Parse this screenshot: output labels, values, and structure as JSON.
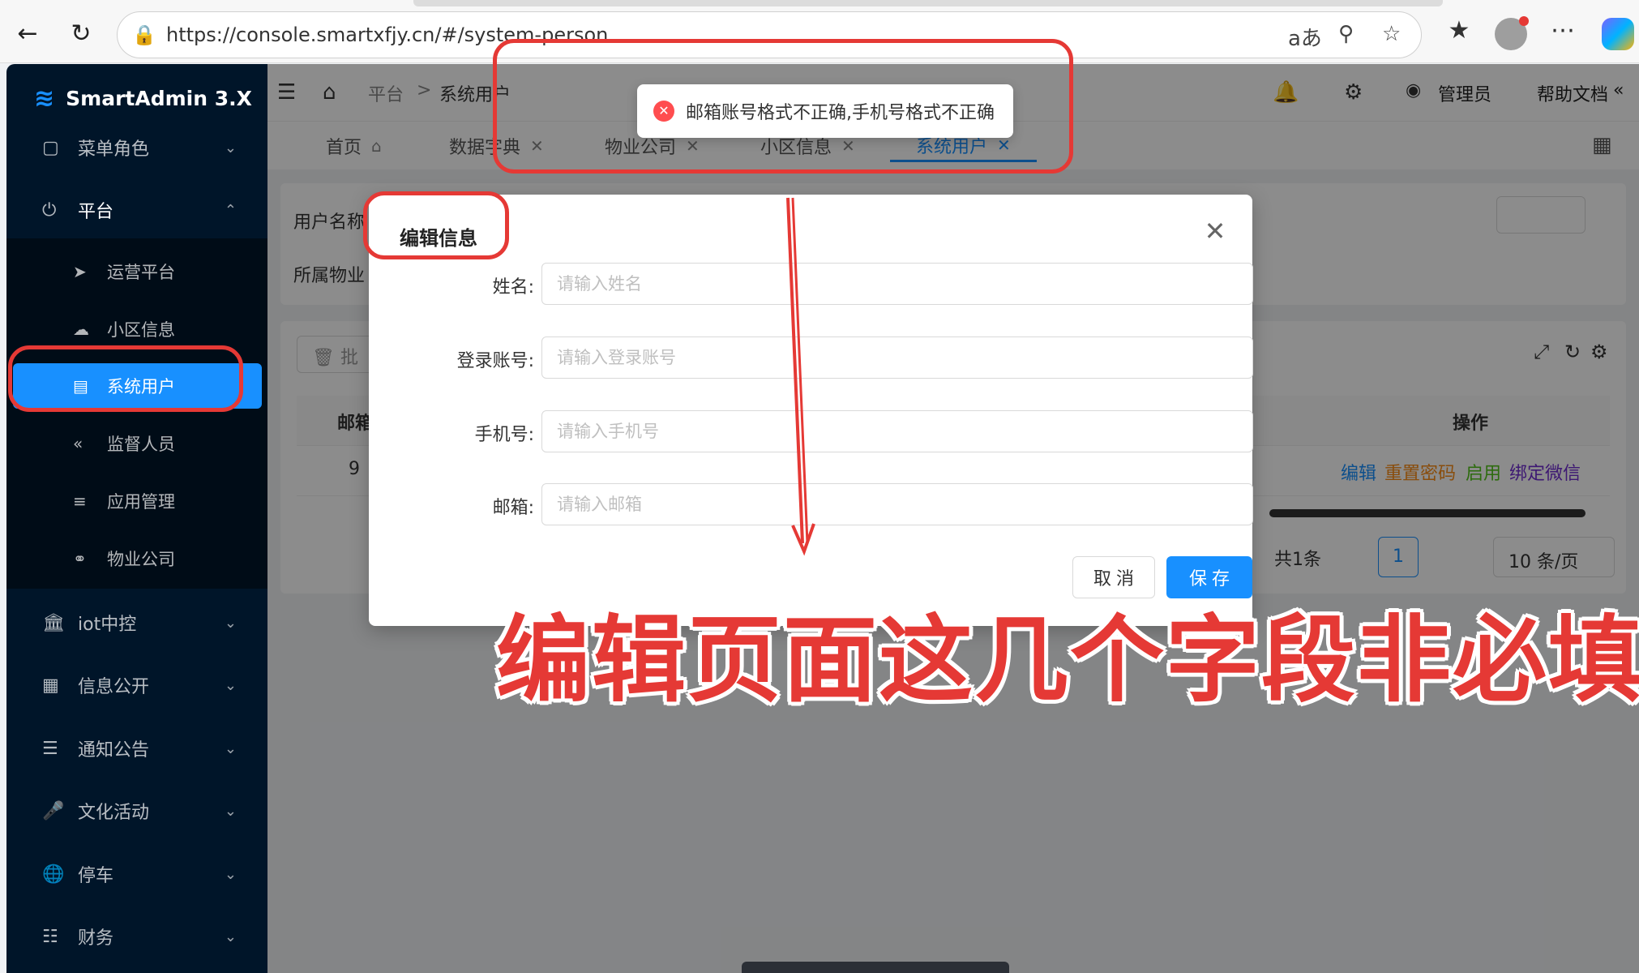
{
  "browser": {
    "url": "https://console.smartxfjy.cn/#/system-person"
  },
  "sidebar": {
    "brand": "SmartAdmin 3.X",
    "items": [
      {
        "label": "菜单角色",
        "icon": "file-icon"
      },
      {
        "label": "平台",
        "icon": "power-icon"
      },
      {
        "label": "iot中控",
        "icon": "bank-icon"
      },
      {
        "label": "信息公开",
        "icon": "grid-icon"
      },
      {
        "label": "通知公告",
        "icon": "list-icon"
      },
      {
        "label": "文化活动",
        "icon": "mic-icon"
      },
      {
        "label": "停车",
        "icon": "globe-icon"
      },
      {
        "label": "财务",
        "icon": "calendar-icon"
      }
    ],
    "sub_items": [
      {
        "label": "运营平台",
        "icon": "rocket-icon"
      },
      {
        "label": "小区信息",
        "icon": "cloud-icon"
      },
      {
        "label": "系统用户",
        "icon": "book-icon"
      },
      {
        "label": "监督人员",
        "icon": "rewind-icon"
      },
      {
        "label": "应用管理",
        "icon": "menu-icon"
      },
      {
        "label": "物业公司",
        "icon": "link-icon"
      }
    ]
  },
  "header": {
    "breadcrumb": [
      "平台",
      ">",
      "系统用户"
    ],
    "user": "管理员",
    "help": "帮助文档"
  },
  "tabs": [
    {
      "label": "首页"
    },
    {
      "label": "数据字典"
    },
    {
      "label": "物业公司"
    },
    {
      "label": "小区信息"
    },
    {
      "label": "系统用户"
    }
  ],
  "background": {
    "filter_user_name": "用户名称",
    "filter_property": "所属物业",
    "batch_button": "批",
    "col_email": "邮箱",
    "col_action": "操作",
    "row_value": "9",
    "actions": [
      "编辑",
      "重置密码",
      "启用",
      "绑定微信"
    ],
    "action_colors": [
      "#1890ff",
      "#fa8c16",
      "#52c41a",
      "#722ed1"
    ],
    "total": "共1条",
    "page": "1",
    "page_size": "10 条/页"
  },
  "toast": {
    "message": "邮箱账号格式不正确,手机号格式不正确"
  },
  "modal": {
    "title": "编辑信息",
    "fields": [
      {
        "label": "姓名:",
        "placeholder": "请输入姓名"
      },
      {
        "label": "登录账号:",
        "placeholder": "请输入登录账号"
      },
      {
        "label": "手机号:",
        "placeholder": "请输入手机号"
      },
      {
        "label": "邮箱:",
        "placeholder": "请输入邮箱"
      }
    ],
    "cancel_label": "取 消",
    "save_label": "保 存"
  },
  "annotation": {
    "note": "编辑页面这几个字段非必填",
    "color": "#e53935"
  }
}
